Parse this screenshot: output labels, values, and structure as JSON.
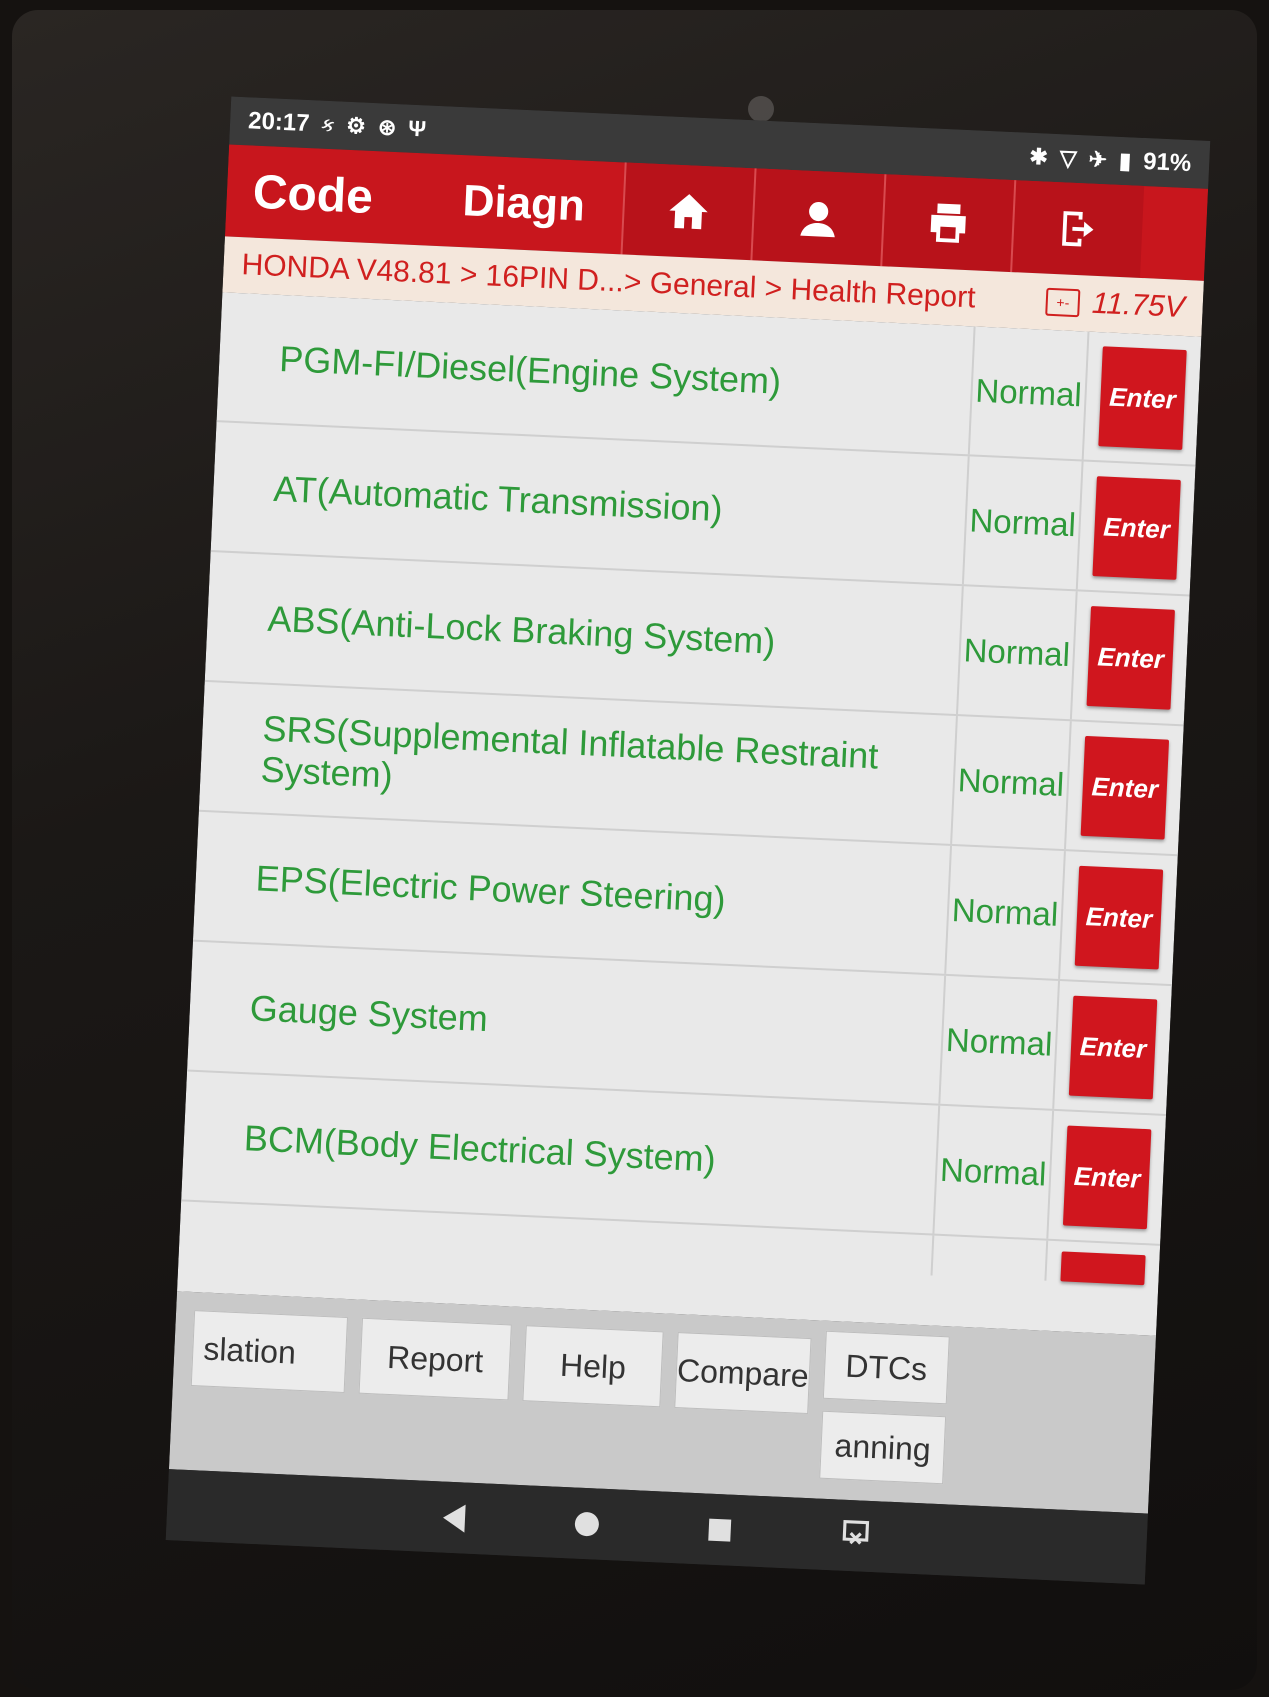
{
  "status_bar": {
    "time": "20:17",
    "suffix": "ક",
    "battery": "91%"
  },
  "header": {
    "title_code": "Code",
    "title_diag": "Diagn"
  },
  "breadcrumb": {
    "path": "HONDA V48.81 > 16PIN D...> General > Health Report",
    "voltage": "11.75V"
  },
  "systems": [
    {
      "name": "PGM-FI/Diesel(Engine System)",
      "status": "Normal",
      "action": "Enter"
    },
    {
      "name": "AT(Automatic Transmission)",
      "status": "Normal",
      "action": "Enter"
    },
    {
      "name": "ABS(Anti-Lock Braking System)",
      "status": "Normal",
      "action": "Enter"
    },
    {
      "name": "SRS(Supplemental Inflatable Restraint System)",
      "status": "Normal",
      "action": "Enter"
    },
    {
      "name": "EPS(Electric Power Steering)",
      "status": "Normal",
      "action": "Enter"
    },
    {
      "name": "Gauge System",
      "status": "Normal",
      "action": "Enter"
    },
    {
      "name": "BCM(Body Electrical System)",
      "status": "Normal",
      "action": "Enter"
    }
  ],
  "toolbar": {
    "btn1": "slation",
    "btn2": "Report",
    "btn3": "Help",
    "btn4": "Compare",
    "btn5": "DTCs",
    "btn6": "anning"
  },
  "colors": {
    "brand_red": "#c8161d",
    "text_green": "#2e9a3a",
    "breadcrumb_bg": "#f4e7dc"
  }
}
